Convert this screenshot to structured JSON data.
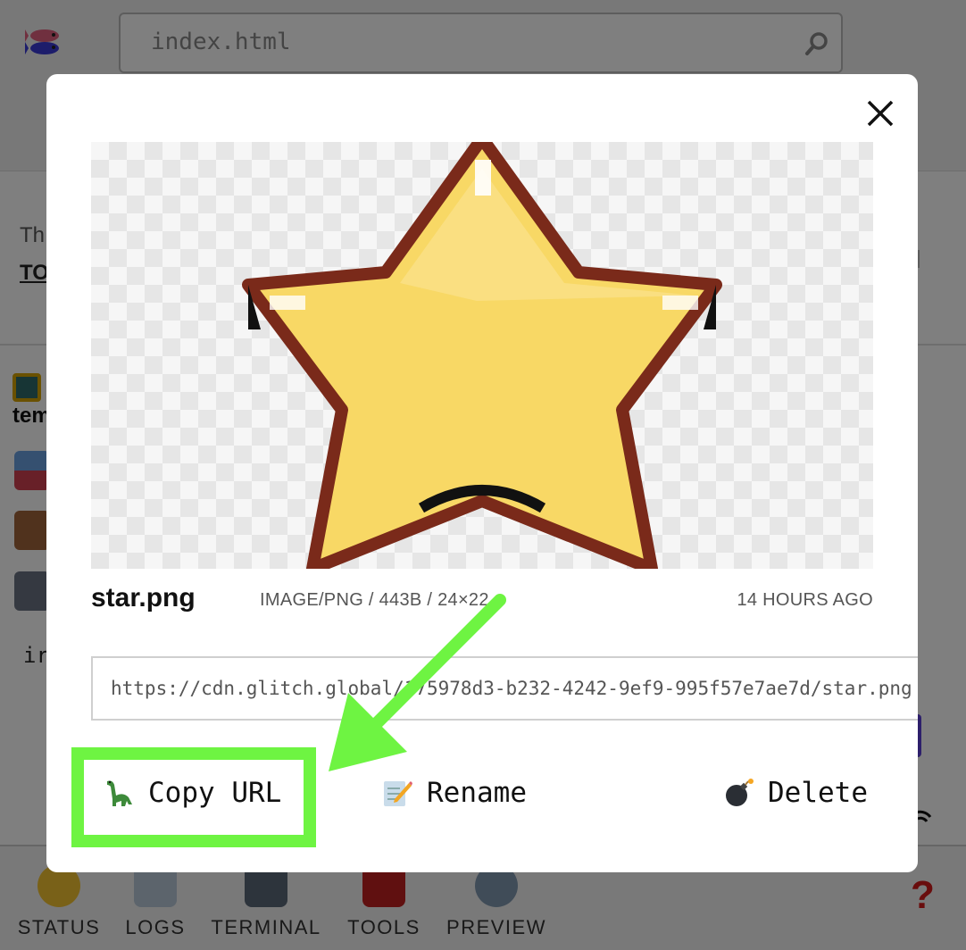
{
  "background": {
    "search_value": "index.html",
    "notice_text": "Th",
    "notice_link": "TO",
    "project_name": "tem",
    "sidebar_text": "ir",
    "bottom_tabs": [
      {
        "label": "STATUS",
        "icon": "grinning-face-icon"
      },
      {
        "label": "LOGS",
        "icon": "memo-icon"
      },
      {
        "label": "TERMINAL",
        "icon": "laptop-icon"
      },
      {
        "label": "TOOLS",
        "icon": "toolbox-icon"
      },
      {
        "label": "PREVIEW",
        "icon": "magnifier-icon"
      }
    ],
    "help_label": "?"
  },
  "modal": {
    "file_name": "star.png",
    "file_meta": "IMAGE/PNG / 443B / 24×22",
    "file_time": "14 HOURS AGO",
    "url": "https://cdn.glitch.global/175978d3-b232-4242-9ef9-995f57e7ae7d/star.png",
    "actions": {
      "copy_url": {
        "label": "Copy URL",
        "icon": "sauropod-icon"
      },
      "rename": {
        "label": "Rename",
        "icon": "memo-pencil-icon"
      },
      "delete": {
        "label": "Delete",
        "icon": "bomb-icon"
      }
    }
  },
  "colors": {
    "annotation": "#6ef442",
    "star_fill": "#f8d865",
    "star_outline": "#7a2a1a"
  }
}
